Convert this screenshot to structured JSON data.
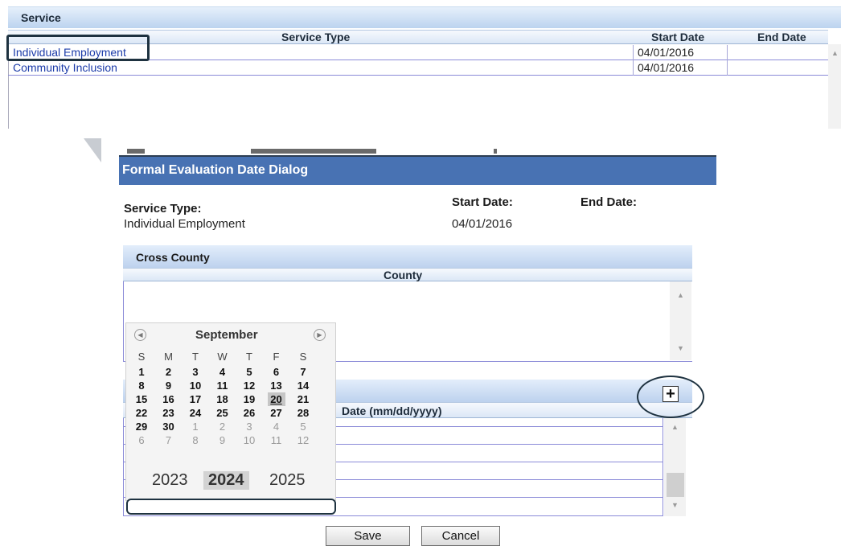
{
  "service": {
    "title": "Service",
    "columns": {
      "service_type": "Service Type",
      "start_date": "Start Date",
      "end_date": "End Date"
    },
    "rows": [
      {
        "service_type": "Individual Employment",
        "start_date": "04/01/2016",
        "end_date": ""
      },
      {
        "service_type": "Community Inclusion",
        "start_date": "04/01/2016",
        "end_date": ""
      }
    ]
  },
  "dialog": {
    "title": "Formal Evaluation Date Dialog",
    "service_type_label": "Service Type:",
    "service_type_value": "Individual Employment",
    "start_date_label": "Start Date:",
    "start_date_value": "04/01/2016",
    "end_date_label": "End Date:",
    "cross_county": {
      "title": "Cross County",
      "column": "County"
    },
    "date_grid": {
      "column": "Date (mm/dd/yyyy)"
    },
    "save_label": "Save",
    "cancel_label": "Cancel"
  },
  "calendar": {
    "month": "September",
    "weekdays": [
      "S",
      "M",
      "T",
      "W",
      "T",
      "F",
      "S"
    ],
    "weeks": [
      [
        "1",
        "2",
        "3",
        "4",
        "5",
        "6",
        "7"
      ],
      [
        "8",
        "9",
        "10",
        "11",
        "12",
        "13",
        "14"
      ],
      [
        "15",
        "16",
        "17",
        "18",
        "19",
        "20",
        "21"
      ],
      [
        "22",
        "23",
        "24",
        "25",
        "26",
        "27",
        "28"
      ],
      [
        "29",
        "30",
        "1",
        "2",
        "3",
        "4",
        "5"
      ],
      [
        "6",
        "7",
        "8",
        "9",
        "10",
        "11",
        "12"
      ]
    ],
    "selected_day": "20",
    "years": [
      "2023",
      "2024",
      "2025"
    ],
    "selected_year": "2024"
  },
  "icons": {
    "prev": "chevron-left-icon",
    "next": "chevron-right-icon",
    "add": "plus-icon"
  }
}
